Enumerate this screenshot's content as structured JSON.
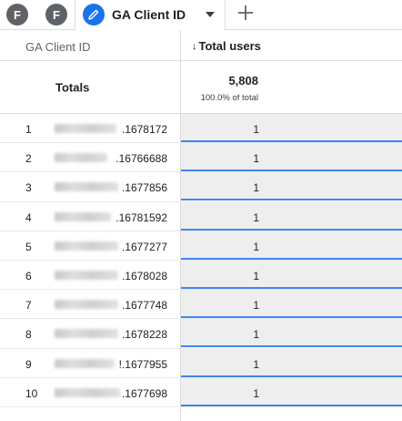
{
  "tabs": {
    "segments": [
      {
        "letter": "F",
        "color": "#5f6368"
      },
      {
        "letter": "F",
        "color": "#5f6368"
      }
    ],
    "active": {
      "label": "GA Client ID",
      "icon": "pencil-icon",
      "accent": "#1a73e8"
    },
    "add_icon": "plus-icon"
  },
  "table": {
    "dimension_header": "GA Client ID",
    "metric_header": "Total users",
    "sort_icon": "arrow-down-icon",
    "totals": {
      "label": "Totals",
      "value": "5,808",
      "percent": "100.0% of total"
    },
    "bar_color": "#4285f4",
    "rows": [
      {
        "index": "1",
        "client_id": ".1678172",
        "value": "1",
        "share": 1
      },
      {
        "index": "2",
        "client_id": ".16766688",
        "value": "1",
        "share": 1
      },
      {
        "index": "3",
        "client_id": ".1677856",
        "value": "1",
        "share": 1
      },
      {
        "index": "4",
        "client_id": ".16781592",
        "value": "1",
        "share": 1
      },
      {
        "index": "5",
        "client_id": ".1677277",
        "value": "1",
        "share": 1
      },
      {
        "index": "6",
        "client_id": ".1678028",
        "value": "1",
        "share": 1
      },
      {
        "index": "7",
        "client_id": ".1677748",
        "value": "1",
        "share": 1
      },
      {
        "index": "8",
        "client_id": ".1678228",
        "value": "1",
        "share": 1
      },
      {
        "index": "9",
        "client_id": "!.1677955",
        "value": "1",
        "share": 1
      },
      {
        "index": "10",
        "client_id": ".1677698",
        "value": "1",
        "share": 1
      }
    ]
  }
}
